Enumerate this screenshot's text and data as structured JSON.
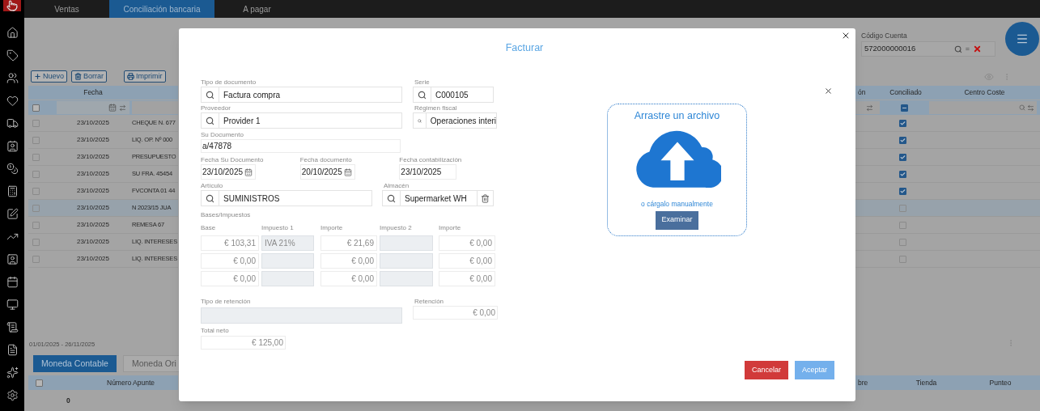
{
  "tabs": [
    {
      "label": "Ventas",
      "selected": false
    },
    {
      "label": "Conciliación bancaria",
      "selected": true
    },
    {
      "label": "A pagar",
      "selected": false
    }
  ],
  "account": {
    "label": "Código Cuenta",
    "value": "572000000016",
    "operator": "="
  },
  "toolbar": {
    "buttons": [
      {
        "label": "Nuevo",
        "kind": "add"
      },
      {
        "label": "Borrar",
        "kind": "delete"
      },
      {
        "label": "Imprimir",
        "kind": "print"
      }
    ]
  },
  "table": {
    "columns": [
      "Fecha",
      "ón",
      "Conciliado",
      "Centro Coste"
    ],
    "select_all_checked": false,
    "reconciled_filter_indeterminate": true,
    "rows": [
      {
        "checked": false,
        "date": "23/10/2025",
        "concept": "CHEQUE N. 677",
        "reconciled": true,
        "selected": false
      },
      {
        "checked": false,
        "date": "23/10/2025",
        "concept": "LIQ. OP. Nº 000",
        "reconciled": true,
        "selected": false
      },
      {
        "checked": false,
        "date": "23/10/2025",
        "concept": "PRESUPUESTO",
        "reconciled": true,
        "selected": false
      },
      {
        "checked": false,
        "date": "23/10/2025",
        "concept": "SU FRA. 45454",
        "reconciled": true,
        "selected": false
      },
      {
        "checked": false,
        "date": "23/10/2025",
        "concept": "FVCONTA 01 44",
        "reconciled": true,
        "selected": false
      },
      {
        "checked": false,
        "date": "23/10/2025",
        "concept": "N 2023/15 JUA",
        "reconciled": false,
        "selected": true
      },
      {
        "checked": false,
        "date": "23/10/2025",
        "concept": "REMESA 67",
        "reconciled": false,
        "selected": false
      },
      {
        "checked": false,
        "date": "23/10/2025",
        "concept": "LIQ. INTERESES",
        "reconciled": false,
        "selected": false
      },
      {
        "checked": false,
        "date": "23/10/2025",
        "concept": "LIQ. INTERESES",
        "reconciled": false,
        "selected": false
      }
    ]
  },
  "date_range": "01/01/2025 - 26/11/2025",
  "currency_tabs": [
    {
      "label": "Moneda Contable",
      "selected": true
    },
    {
      "label": "Moneda Ori",
      "selected": false
    }
  ],
  "entries_table": {
    "select_all_checked": false,
    "columns": [
      "Número Apunte",
      "bre",
      "Tienda",
      "Punteo"
    ],
    "rows": [
      [
        "0"
      ]
    ]
  },
  "dialog": {
    "title": "Facturar",
    "document_type": {
      "label": "Tipo de documento",
      "value": "Factura compra"
    },
    "series": {
      "label": "Serie",
      "value": "C000105"
    },
    "supplier": {
      "label": "Proveedor",
      "value": "Provider 1"
    },
    "tax_regime": {
      "label": "Régimen fiscal",
      "value": "Operaciones interi"
    },
    "your_document": {
      "label": "Su Documento",
      "value": "a/47878"
    },
    "dates": [
      {
        "label": "Fecha Su Documento",
        "value": "23/10/2025",
        "kind": "picker"
      },
      {
        "label": "Fecha documento",
        "value": "20/10/2025",
        "kind": "picker"
      },
      {
        "label": "Fecha contabilización",
        "value": "23/10/2025",
        "kind": "plain"
      }
    ],
    "item": {
      "label": "Artículo",
      "value": "SUMINISTROS"
    },
    "warehouse": {
      "label": "Almacén",
      "value": "Supermarket WH"
    },
    "bases_taxes": {
      "label": "Bases/Impuestos",
      "columns": [
        "Base",
        "Impuesto 1",
        "Importe",
        "Impuesto 2",
        "Importe"
      ],
      "rows": [
        {
          "base": "€ 103,31",
          "tax_1": "IVA 21%",
          "amount_1": "€ 21,69",
          "amount_2": "€ 0,00"
        },
        {
          "base": "€ 0,00",
          "amount_1": "€ 0,00",
          "amount_2": "€ 0,00"
        },
        {
          "base": "€ 0,00",
          "amount_1": "€ 0,00",
          "amount_2": "€ 0,00"
        }
      ]
    },
    "withholding_type": {
      "label": "Tipo de retención"
    },
    "withholding": {
      "label": "Retención",
      "value": "€ 0,00"
    },
    "net_total": {
      "label": "Total neto",
      "value": "€ 125,00"
    },
    "upload": {
      "title": "Arrastre un archivo",
      "subtitle": "o cárgalo manualmente",
      "button": "Examinar"
    },
    "buttons": [
      {
        "label": "Cancelar",
        "kind": "cancel"
      },
      {
        "label": "Aceptar",
        "kind": "accept"
      }
    ]
  }
}
